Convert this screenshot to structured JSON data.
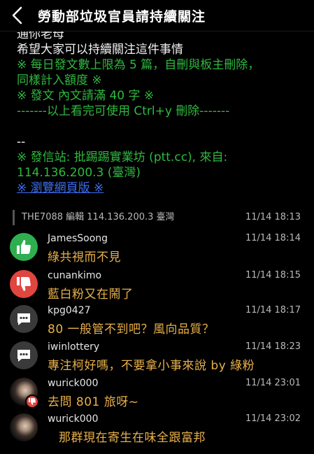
{
  "header": {
    "title": "勞動部垃圾官員請持續關注"
  },
  "article": {
    "lines": [
      {
        "text": "通你老母",
        "color": "white"
      },
      {
        "text": "希望大家可以持續關注這件事情",
        "color": "white"
      },
      {
        "text": "※ 每日發文數上限為 5 篇，自刪與板主刪除，",
        "color": "green"
      },
      {
        "text": "同樣計入額度 ※",
        "color": "green"
      },
      {
        "text": "※ 發文 內文請滿 40 字 ※",
        "color": "green"
      },
      {
        "text": "-------以上看完可使用 Ctrl+y 刪除-------",
        "color": "green"
      },
      {
        "text": "",
        "color": "white"
      },
      {
        "text": "--",
        "color": "white"
      },
      {
        "text": "※ 發信站: 批踢踢實業坊 (ptt.cc), 來自:",
        "color": "green"
      },
      {
        "text": "114.136.200.3 (臺灣)",
        "color": "green"
      }
    ],
    "browse_link": "※ 瀏覽網頁版 ※"
  },
  "edit_note": {
    "text": "THE7088 編輯 114.136.200.3 臺灣",
    "time": "11/14 18:13"
  },
  "pushes": [
    {
      "type": "good",
      "icon": "thumbs-up-icon",
      "user": "JamesSoong",
      "time": "11/14 18:14",
      "text": "綠共視而不見"
    },
    {
      "type": "bad",
      "icon": "thumbs-down-icon",
      "user": "cunankimo",
      "time": "11/14 18:15",
      "text": "藍白粉又在鬧了"
    },
    {
      "type": "neutral",
      "icon": "comment-icon",
      "user": "kpg0427",
      "time": "11/14 18:17",
      "text": "80 一般管不到吧？風向品質？"
    },
    {
      "type": "neutral",
      "icon": "comment-icon",
      "user": "iwinlottery",
      "time": "11/14 18:23",
      "text": "專注柯好嗎，不要拿小事來說 by 綠粉"
    },
    {
      "type": "bad-photo",
      "icon": "user-photo-avatar",
      "user": "wurick000",
      "time": "11/14 23:01",
      "text": "去問 801 旅呀~"
    },
    {
      "type": "photo",
      "icon": "user-photo-avatar",
      "user": "wurick000",
      "time": "11/14 23:02",
      "text": "那群現在寄生在味全跟富邦"
    }
  ],
  "colors": {
    "green": "#2fb93f",
    "good": "#2fae4f",
    "bad": "#e0453f",
    "push_text": "#e8b04a",
    "link": "#3d6ff5"
  }
}
